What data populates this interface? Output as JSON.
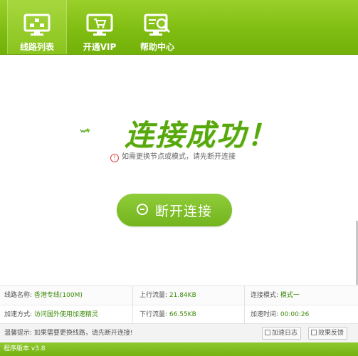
{
  "nav": {
    "items": [
      {
        "label": "线路列表",
        "icon": "monitor-icon"
      },
      {
        "label": "开通VIP",
        "icon": "cart-icon"
      },
      {
        "label": "帮助中心",
        "icon": "help-search-icon"
      }
    ],
    "active": 0
  },
  "status_heading": "连接成功！",
  "tip": "如需更换节点或模式，请先断开连接",
  "disconnect_label": "断开连接",
  "info": {
    "line_name_label": "线路名称:",
    "line_name_value": "香港专线(100M)",
    "upload_label": "上行流量:",
    "upload_value": "21.84KB",
    "mode_label": "连接模式:",
    "mode_value": "模式一",
    "accel_label": "加速方式:",
    "accel_value": "访问国外使用加速精灵",
    "download_label": "下行流量:",
    "download_value": "66.55KB",
    "time_label": "加速时间:",
    "time_value": "00:00:26"
  },
  "hint": {
    "text": "温馨提示: 如果需要更换线路，请先断开连接!",
    "log_button": "加速日志",
    "feedback_button": "效果反馈"
  },
  "status_bar": "程序版本 v3.8",
  "colors": {
    "brand_green": "#80bd12",
    "accent_green": "#56a80c",
    "warn_red": "#e0463b"
  }
}
